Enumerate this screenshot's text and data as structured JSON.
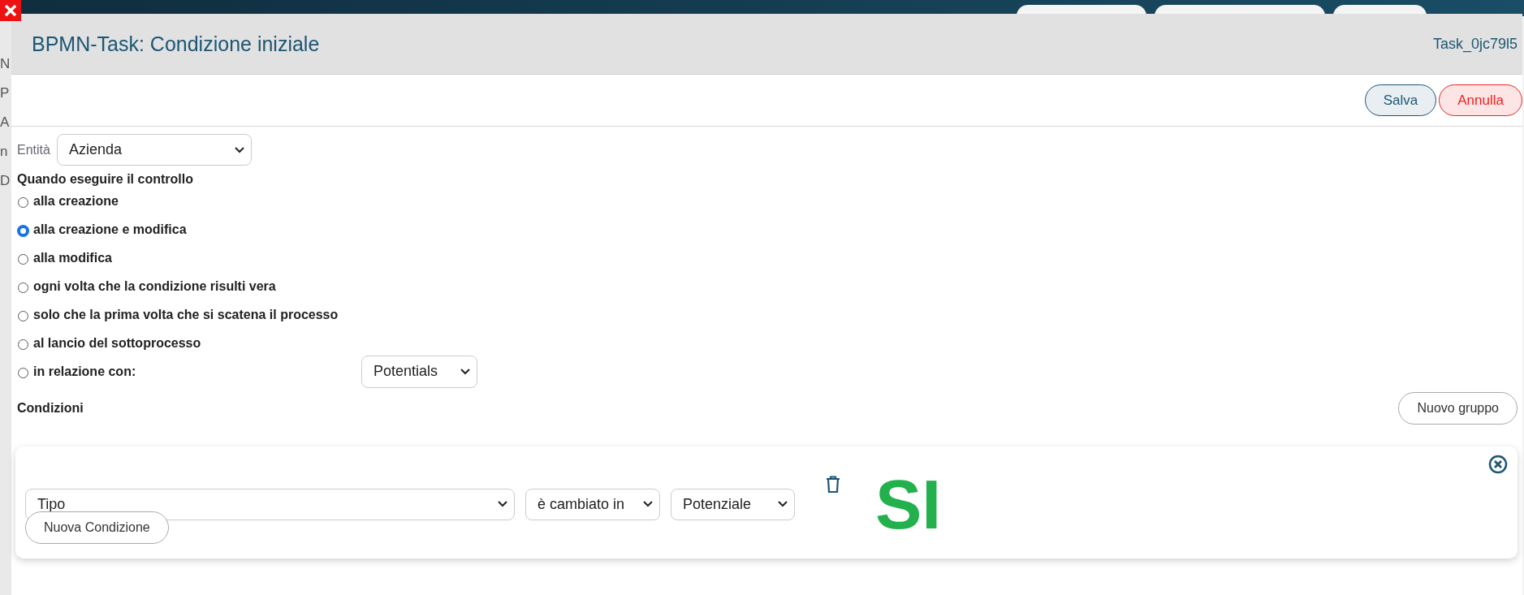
{
  "background": {
    "fragments": [
      "N",
      "P",
      "A",
      "n",
      "D"
    ]
  },
  "dialog": {
    "title": "BPMN-Task: Condizione iniziale",
    "task_id": "Task_0jc79l5",
    "buttons": [
      {
        "label": "Salva",
        "kind": "primary"
      },
      {
        "label": "Annulla",
        "kind": "cancel"
      }
    ],
    "entity": {
      "label": "Entità",
      "value": "Azienda"
    },
    "when": {
      "heading": "Quando eseguire il controllo",
      "options": [
        {
          "label": "alla creazione",
          "selected": false
        },
        {
          "label": "alla creazione e modifica",
          "selected": true
        },
        {
          "label": "alla modifica",
          "selected": false
        },
        {
          "label": "ogni volta che la condizione risulti vera",
          "selected": false
        },
        {
          "label": "solo che la prima volta che si scatena il processo",
          "selected": false
        },
        {
          "label": "al lancio del sottoprocesso",
          "selected": false
        },
        {
          "label": "in relazione con:",
          "selected": false
        }
      ],
      "relation_value": "Potentials"
    },
    "conditions": {
      "heading": "Condizioni",
      "new_group_button": "Nuovo gruppo",
      "groups": [
        {
          "rows": [
            {
              "field": "Tipo",
              "operator": "è cambiato in",
              "value": "Potenziale",
              "result": "SI"
            }
          ],
          "new_condition_button": "Nuova Condizione"
        }
      ]
    }
  }
}
